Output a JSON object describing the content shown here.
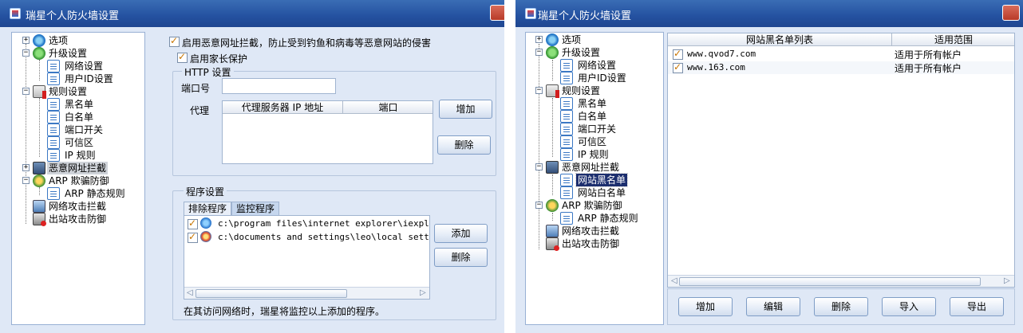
{
  "left_window": {
    "title": "瑞星个人防火墙设置",
    "tree": {
      "options": "选项",
      "upgrade": "升级设置",
      "network": "网络设置",
      "userid": "用户ID设置",
      "rules": "规则设置",
      "blacklist": "黑名单",
      "whitelist": "白名单",
      "port": "端口开关",
      "trusted": "可信区",
      "ip_rules": "IP 规则",
      "malicious_url": "恶意网址拦截",
      "arp": "ARP 欺骗防御",
      "arp_static": "ARP 静态规则",
      "net_attack": "网络攻击拦截",
      "out_attack": "出站攻击防御"
    },
    "enable_url_block": "启用恶意网址拦截，防止受到钓鱼和病毒等恶意网站的侵害",
    "enable_parental": "启用家长保护",
    "http_group": "HTTP 设置",
    "port_label": "端口号",
    "port_value": "",
    "proxy_label": "代理",
    "proxy_columns": [
      "代理服务器 IP 地址",
      "端口"
    ],
    "add_button": "增加",
    "delete_button": "删除",
    "program_group": "程序设置",
    "tabs": [
      "排除程序",
      "监控程序"
    ],
    "programs": [
      "c:\\program files\\internet explorer\\iexplore.",
      "c:\\documents and settings\\leo\\local settings"
    ],
    "program_add": "添加",
    "program_delete": "删除",
    "footer_note": "在其访问网络时，瑞星将监控以上添加的程序。"
  },
  "right_window": {
    "title": "瑞星个人防火墙设置",
    "tree": {
      "options": "选项",
      "upgrade": "升级设置",
      "network": "网络设置",
      "userid": "用户ID设置",
      "rules": "规则设置",
      "blacklist": "黑名单",
      "whitelist": "白名单",
      "port": "端口开关",
      "trusted": "可信区",
      "ip_rules": "IP 规则",
      "malicious_url": "恶意网址拦截",
      "site_blacklist": "网站黑名单",
      "site_whitelist": "网站白名单",
      "arp": "ARP 欺骗防御",
      "arp_static": "ARP 静态规则",
      "net_attack": "网络攻击拦截",
      "out_attack": "出站攻击防御"
    },
    "columns": [
      "网站黑名单列表",
      "适用范围"
    ],
    "rows": [
      {
        "site": "www.qvod7.com",
        "scope": "适用于所有帐户"
      },
      {
        "site": "www.163.com",
        "scope": "适用于所有帐户"
      }
    ],
    "buttons": [
      "增加",
      "编辑",
      "删除",
      "导入",
      "导出"
    ]
  }
}
